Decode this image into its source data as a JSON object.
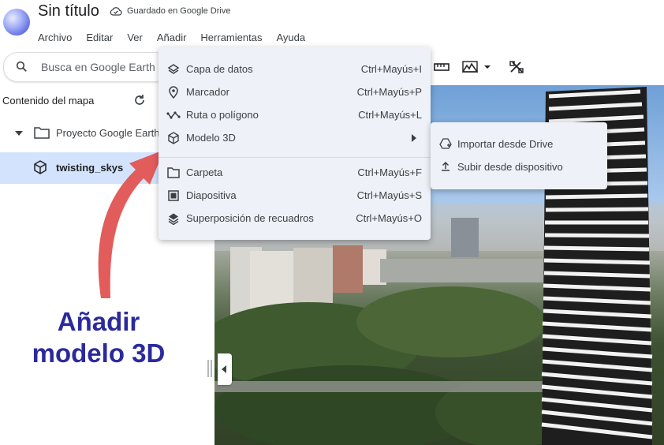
{
  "header": {
    "title": "Sin título",
    "drive_status": "Guardado en Google Drive"
  },
  "menubar": [
    "Archivo",
    "Editar",
    "Ver",
    "Añadir",
    "Herramientas",
    "Ayuda"
  ],
  "search": {
    "placeholder": "Busca en Google Earth"
  },
  "panel": {
    "title": "Contenido del mapa",
    "project": "Proyecto Google Earth",
    "selected_item": "twisting_skys"
  },
  "add_menu": {
    "items": [
      {
        "label": "Capa de datos",
        "shortcut": "Ctrl+Mayús+I",
        "icon": "layers-icon"
      },
      {
        "label": "Marcador",
        "shortcut": "Ctrl+Mayús+P",
        "icon": "placemark-icon"
      },
      {
        "label": "Ruta o polígono",
        "shortcut": "Ctrl+Mayús+L",
        "icon": "path-icon"
      },
      {
        "label": "Modelo 3D",
        "shortcut": "",
        "icon": "cube-icon"
      },
      {
        "label": "Carpeta",
        "shortcut": "Ctrl+Mayús+F",
        "icon": "folder-icon"
      },
      {
        "label": "Diapositiva",
        "shortcut": "Ctrl+Mayús+S",
        "icon": "slide-icon"
      },
      {
        "label": "Superposición de recuadros",
        "shortcut": "Ctrl+Mayús+O",
        "icon": "overlay-icon"
      }
    ]
  },
  "model3d_submenu": {
    "items": [
      {
        "label": "Importar desde Drive",
        "icon": "drive-import-icon"
      },
      {
        "label": "Subir desde dispositivo",
        "icon": "upload-icon"
      }
    ]
  },
  "annotation": {
    "line1": "Añadir",
    "line2": "modelo 3D"
  },
  "colors": {
    "accent": "#d3e3fd",
    "annotation_text": "#2b2a9c",
    "arrow": "#e25c5c",
    "menu_bg": "#eef2f8"
  }
}
